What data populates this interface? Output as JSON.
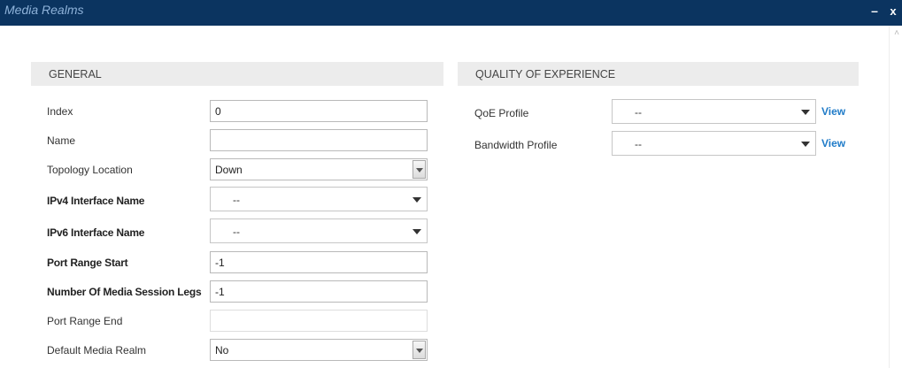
{
  "window": {
    "title": "Media Realms",
    "minimize_label": "–",
    "close_label": "x"
  },
  "general": {
    "header": "GENERAL",
    "fields": [
      {
        "label": "Index",
        "value": "0"
      },
      {
        "label": "Name",
        "value": ""
      },
      {
        "label": "Topology Location",
        "value": "Down"
      },
      {
        "label": "IPv4 Interface Name",
        "value": "--"
      },
      {
        "label": "IPv6 Interface Name",
        "value": "--"
      },
      {
        "label": "Port Range Start",
        "value": "-1"
      },
      {
        "label": "Number Of Media Session Legs",
        "value": "-1"
      },
      {
        "label": "Port Range End",
        "value": ""
      },
      {
        "label": "Default Media Realm",
        "value": "No"
      }
    ]
  },
  "qoe": {
    "header": "QUALITY OF EXPERIENCE",
    "fields": [
      {
        "label": "QoE Profile",
        "value": "--",
        "link": "View"
      },
      {
        "label": "Bandwidth Profile",
        "value": "--",
        "link": "View"
      }
    ]
  },
  "colors": {
    "titlebar": "#0b3460",
    "title_text": "#8fb3da",
    "link": "#1f7bc8",
    "section_bg": "#ececec"
  }
}
